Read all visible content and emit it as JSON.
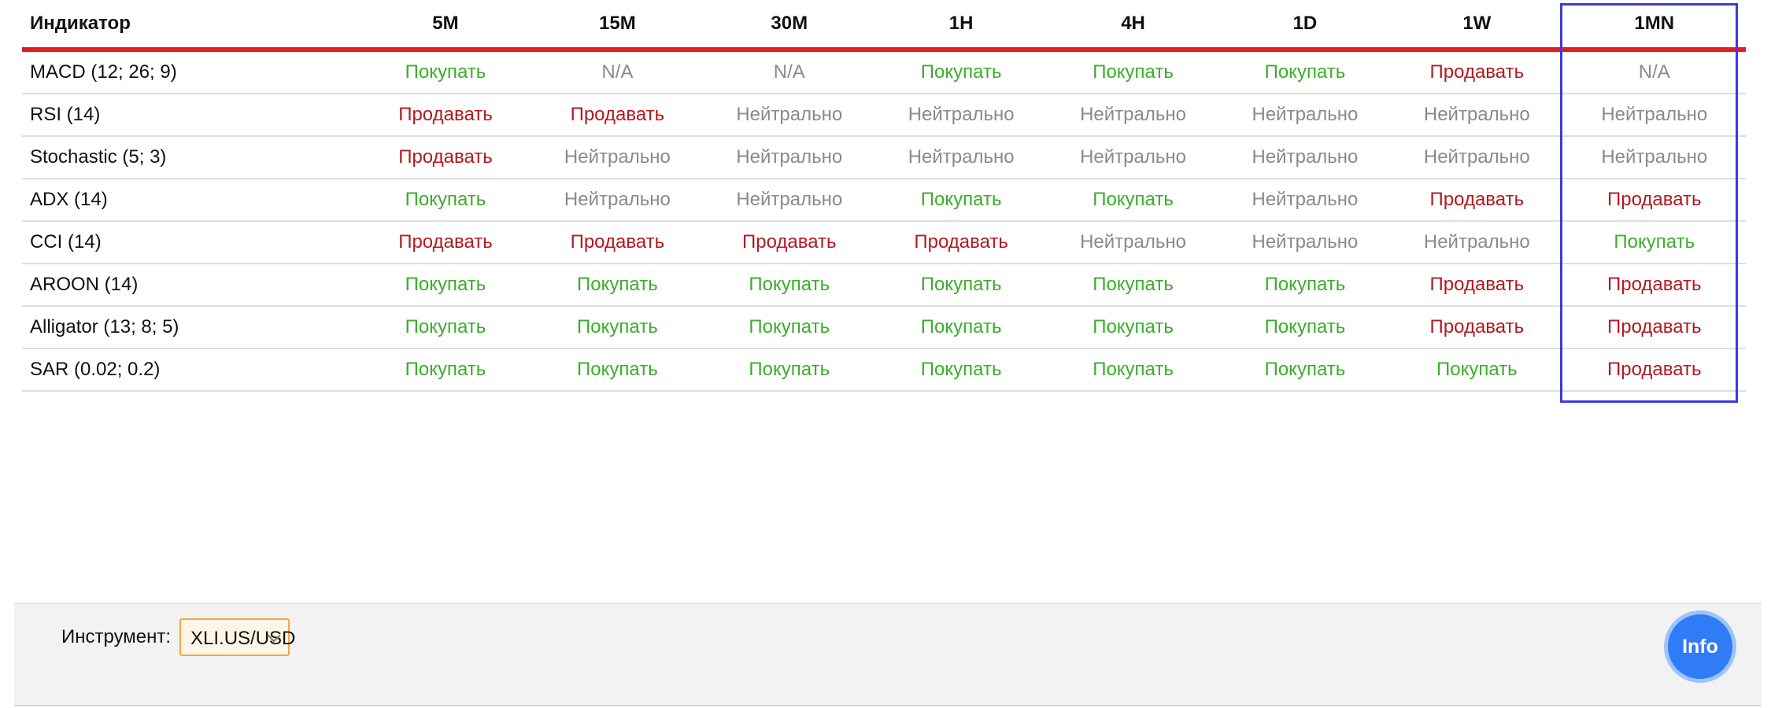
{
  "table": {
    "header": {
      "indicator": "Индикатор",
      "timeframes": [
        "5M",
        "15M",
        "30M",
        "1H",
        "4H",
        "1D",
        "1W",
        "1MN"
      ]
    },
    "rows": [
      {
        "name": "MACD (12; 26; 9)",
        "values": [
          "Покупать",
          "N/A",
          "N/A",
          "Покупать",
          "Покупать",
          "Покупать",
          "Продавать",
          "N/A"
        ]
      },
      {
        "name": "RSI (14)",
        "values": [
          "Продавать",
          "Продавать",
          "Нейтрально",
          "Нейтрально",
          "Нейтрально",
          "Нейтрально",
          "Нейтрально",
          "Нейтрально"
        ]
      },
      {
        "name": "Stochastic (5; 3)",
        "values": [
          "Продавать",
          "Нейтрально",
          "Нейтрально",
          "Нейтрально",
          "Нейтрально",
          "Нейтрально",
          "Нейтрально",
          "Нейтрально"
        ]
      },
      {
        "name": "ADX (14)",
        "values": [
          "Покупать",
          "Нейтрально",
          "Нейтрально",
          "Покупать",
          "Покупать",
          "Нейтрально",
          "Продавать",
          "Продавать"
        ]
      },
      {
        "name": "CCI (14)",
        "values": [
          "Продавать",
          "Продавать",
          "Продавать",
          "Продавать",
          "Нейтрально",
          "Нейтрально",
          "Нейтрально",
          "Покупать"
        ]
      },
      {
        "name": "AROON (14)",
        "values": [
          "Покупать",
          "Покупать",
          "Покупать",
          "Покупать",
          "Покупать",
          "Покупать",
          "Продавать",
          "Продавать"
        ]
      },
      {
        "name": "Alligator (13; 8; 5)",
        "values": [
          "Покупать",
          "Покупать",
          "Покупать",
          "Покупать",
          "Покупать",
          "Покупать",
          "Продавать",
          "Продавать"
        ]
      },
      {
        "name": "SAR (0.02; 0.2)",
        "values": [
          "Покупать",
          "Покупать",
          "Покупать",
          "Покупать",
          "Покупать",
          "Покупать",
          "Покупать",
          "Продавать"
        ]
      }
    ],
    "signal_colors": {
      "Покупать": "#3aae2a",
      "Продавать": "#b4191f",
      "Нейтрально": "#8a8a8a",
      "N/A": "#8a8a8a"
    },
    "accent_color": "#e21c23",
    "highlight_color": "#3b3bdb"
  },
  "toolbar": {
    "instrument_label": "Инструмент:",
    "instrument_value": "XLI.US/USD",
    "info_label": "Info",
    "info_icon": "info-button-circle"
  }
}
